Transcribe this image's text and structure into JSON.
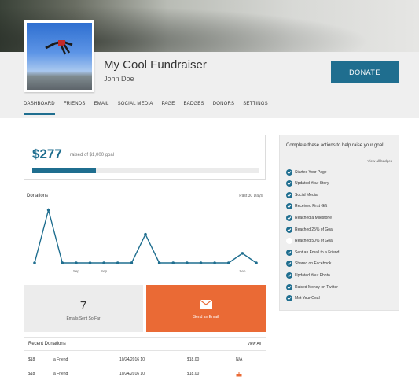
{
  "header": {
    "title": "My Cool Fundraiser",
    "owner": "John Doe",
    "donate_label": "DONATE"
  },
  "tabs": [
    {
      "label": "DASHBOARD",
      "active": true
    },
    {
      "label": "FRIENDS"
    },
    {
      "label": "EMAIL"
    },
    {
      "label": "SOCIAL MEDIA"
    },
    {
      "label": "PAGE"
    },
    {
      "label": "BADGES"
    },
    {
      "label": "DONORS"
    },
    {
      "label": "SETTINGS"
    }
  ],
  "raised": {
    "amount": "$277",
    "of_text": "raised of $1,000 goal",
    "progress_fraction": 0.28
  },
  "chart": {
    "title": "Donations",
    "range_label": "Past 30 Days",
    "color": "#1f6e8f"
  },
  "chart_data": {
    "type": "line",
    "title": "Donations",
    "x": [
      "",
      "",
      "",
      "Sep",
      "",
      "Sep",
      "",
      "",
      "",
      "",
      "",
      "",
      "",
      "",
      "",
      "Sep",
      ""
    ],
    "series": [
      {
        "values": [
          0,
          5,
          0,
          0,
          0,
          0,
          0,
          0,
          2.7,
          0,
          0,
          0,
          0,
          0,
          0,
          0.9,
          0
        ]
      }
    ],
    "ylim": [
      0,
      5.5
    ],
    "grid": false
  },
  "stats": {
    "number": "7",
    "label": "Emails Sent So Far"
  },
  "email_action": {
    "label": "Send an Email",
    "icon": "envelope-icon"
  },
  "recent": {
    "title": "Recent Donations",
    "view_all": "View All",
    "rows": [
      {
        "a": "$18",
        "b": "a Friend",
        "c": "10/24/2016 10",
        "d": "$18.00",
        "e": "N/A",
        "cake": false
      },
      {
        "a": "$18",
        "b": "a Friend",
        "c": "10/24/2016 10",
        "d": "$18.00",
        "e": "",
        "cake": true
      }
    ]
  },
  "sidebar": {
    "title": "Complete these actions to help raise your goal!",
    "link": "View all badges",
    "badges": [
      {
        "label": "Started Your Page",
        "done": true
      },
      {
        "label": "Updated Your Story",
        "done": true
      },
      {
        "label": "Social Media",
        "done": true
      },
      {
        "label": "Received First Gift",
        "done": true
      },
      {
        "label": "Reached a Milestone",
        "done": true
      },
      {
        "label": "Reached 25% of Goal",
        "done": true
      },
      {
        "label": "Reached 50% of Goal",
        "done": false
      },
      {
        "label": "Sent an Email to a Friend",
        "done": true
      },
      {
        "label": "Shared on Facebook",
        "done": true
      },
      {
        "label": "Updated Your Photo",
        "done": true
      },
      {
        "label": "Raised Money on Twitter",
        "done": true
      },
      {
        "label": "Met Your Goal",
        "done": true
      }
    ]
  }
}
